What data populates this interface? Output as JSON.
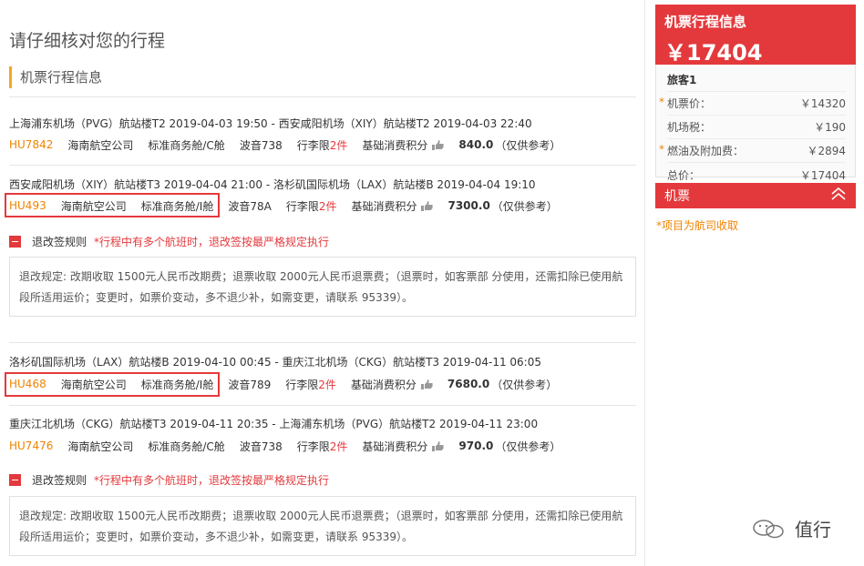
{
  "page": {
    "title": "请仔细核对您的行程",
    "section": "机票行程信息"
  },
  "segments": [
    {
      "route": "上海浦东机场（PVG）航站楼T2 2019-04-03 19:50 - 西安咸阳机场（XIY）航站楼T2 2019-04-03 22:40",
      "flight_no": "HU7842",
      "airline": "海南航空公司",
      "cabin": "标准商务舱/C舱",
      "aircraft": "波音738",
      "baggage_label": "行李限",
      "baggage": "2件",
      "points_label": "基础消费积分",
      "points": "840.0",
      "points_note": "（仅供参考）"
    },
    {
      "route": "西安咸阳机场（XIY）航站楼T3 2019-04-04 21:00 - 洛杉矶国际机场（LAX）航站楼B 2019-04-04 19:10",
      "flight_no": "HU493",
      "airline": "海南航空公司",
      "cabin": "标准商务舱/I舱",
      "aircraft": "波音78A",
      "baggage_label": "行李限",
      "baggage": "2件",
      "points_label": "基础消费积分",
      "points": "7300.0",
      "points_note": "（仅供参考）"
    },
    {
      "route": "洛杉矶国际机场（LAX）航站楼B 2019-04-10 00:45 - 重庆江北机场（CKG）航站楼T3 2019-04-11 06:05",
      "flight_no": "HU468",
      "airline": "海南航空公司",
      "cabin": "标准商务舱/I舱",
      "aircraft": "波音789",
      "baggage_label": "行李限",
      "baggage": "2件",
      "points_label": "基础消费积分",
      "points": "7680.0",
      "points_note": "（仅供参考）"
    },
    {
      "route": "重庆江北机场（CKG）航站楼T3 2019-04-11 20:35 - 上海浦东机场（PVG）航站楼T2 2019-04-11 23:00",
      "flight_no": "HU7476",
      "airline": "海南航空公司",
      "cabin": "标准商务舱/C舱",
      "aircraft": "波音738",
      "baggage_label": "行李限",
      "baggage": "2件",
      "points_label": "基础消费积分",
      "points": "970.0",
      "points_note": "（仅供参考）"
    }
  ],
  "rules": {
    "label": "退改签规则",
    "warning": "*行程中有多个航班时，退改签按最严格规定执行",
    "line1": "退改规定: 改期收取 1500元人民币改期费；退票收取 2000元人民币退票费；（退票时，如客票部 分使用，还需扣除已使用航",
    "line2": "段所适用运价；变更时，如票价变动，多不退少补，如需变更，请联系 95339）。"
  },
  "sidebar": {
    "title": "机票行程信息",
    "total_price": "￥17404",
    "passenger": "旅客1",
    "fares": [
      {
        "label": "机票价：",
        "value": "￥14320",
        "required": true
      },
      {
        "label": "机场税：",
        "value": "￥190",
        "required": false
      },
      {
        "label": "燃油及附加费：",
        "value": "￥2894",
        "required": true
      },
      {
        "label": "总价：",
        "value": "￥17404",
        "required": false
      }
    ],
    "star": "*",
    "ticket_section": "机票",
    "note": "*项目为航司收取"
  },
  "watermark": {
    "text": "值行"
  },
  "colors": {
    "accent": "#e4393c",
    "orange": "#f08300"
  }
}
